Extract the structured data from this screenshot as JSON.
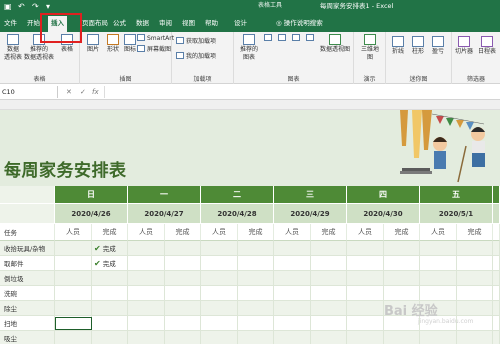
{
  "titlebar": {
    "qa_icons": [
      "save-icon",
      "undo-icon",
      "redo-icon"
    ],
    "qa_glyphs": [
      "▣",
      "↶",
      "↷",
      "▾"
    ],
    "context_tab_title": "表格工具",
    "doc_title": "每周家务安排表1 - Excel"
  },
  "tabs": [
    {
      "label": "文件"
    },
    {
      "label": "开始"
    },
    {
      "label": "插入",
      "active": true
    },
    {
      "label": "页面布局"
    },
    {
      "label": "公式"
    },
    {
      "label": "数据"
    },
    {
      "label": "审阅"
    },
    {
      "label": "视图"
    },
    {
      "label": "帮助"
    },
    {
      "label": "设计"
    }
  ],
  "tell_me": "操作说明搜索",
  "ribbon": {
    "groups": {
      "tables": "表格",
      "illustrations": "插图",
      "addins": "加载项",
      "charts": "图表",
      "tours": "演示",
      "sparklines": "迷你图",
      "filters": "筛选器"
    },
    "buttons": {
      "pivot": "数据\n透视表",
      "recommended_pivot": "推荐的\n数据透视表",
      "table": "表格",
      "pictures": "图片",
      "shapes": "形状",
      "icons": "图标",
      "smartart": "SmartArt",
      "screenshot": "屏幕截图",
      "get_addins": "获取加载项",
      "my_addins": "我的加载项",
      "recommended_charts": "推荐的\n图表",
      "pivot_chart": "数据透视图",
      "map3d": "三维地\n图",
      "line": "折线",
      "column": "柱形",
      "winloss": "盈亏",
      "slicer": "切片器",
      "timeline": "日程表"
    }
  },
  "formula_bar": {
    "name_box": "C10",
    "cancel": "✕",
    "enter": "✓",
    "fx": "fx"
  },
  "sheet": {
    "title": "每周家务安排表",
    "columns": [
      {
        "day": "日",
        "date": "2020/4/26"
      },
      {
        "day": "一",
        "date": "2020/4/27"
      },
      {
        "day": "二",
        "date": "2020/4/28"
      },
      {
        "day": "三",
        "date": "2020/4/29"
      },
      {
        "day": "四",
        "date": "2020/4/30"
      },
      {
        "day": "五",
        "date": "2020/5/1"
      }
    ],
    "task_header": "任务",
    "sub_person": "人员",
    "sub_done": "完成",
    "tasks": [
      {
        "name": "收拾玩具/杂物",
        "done0": "完成"
      },
      {
        "name": "取邮件",
        "done0": "完成"
      },
      {
        "name": "倒垃圾",
        "done0": ""
      },
      {
        "name": "洗碗",
        "done0": ""
      },
      {
        "name": "除尘",
        "done0": ""
      },
      {
        "name": "扫地",
        "done0": ""
      },
      {
        "name": "吸尘",
        "done0": ""
      }
    ]
  },
  "watermark": {
    "text": "Bai 经验",
    "sub": "jingyan.baidu.com"
  },
  "colors": {
    "excel_green": "#217346",
    "header_green": "#4e8a36",
    "date_row": "#cfe0c5",
    "band": "#eef3ea",
    "highlight": "#e02020"
  }
}
